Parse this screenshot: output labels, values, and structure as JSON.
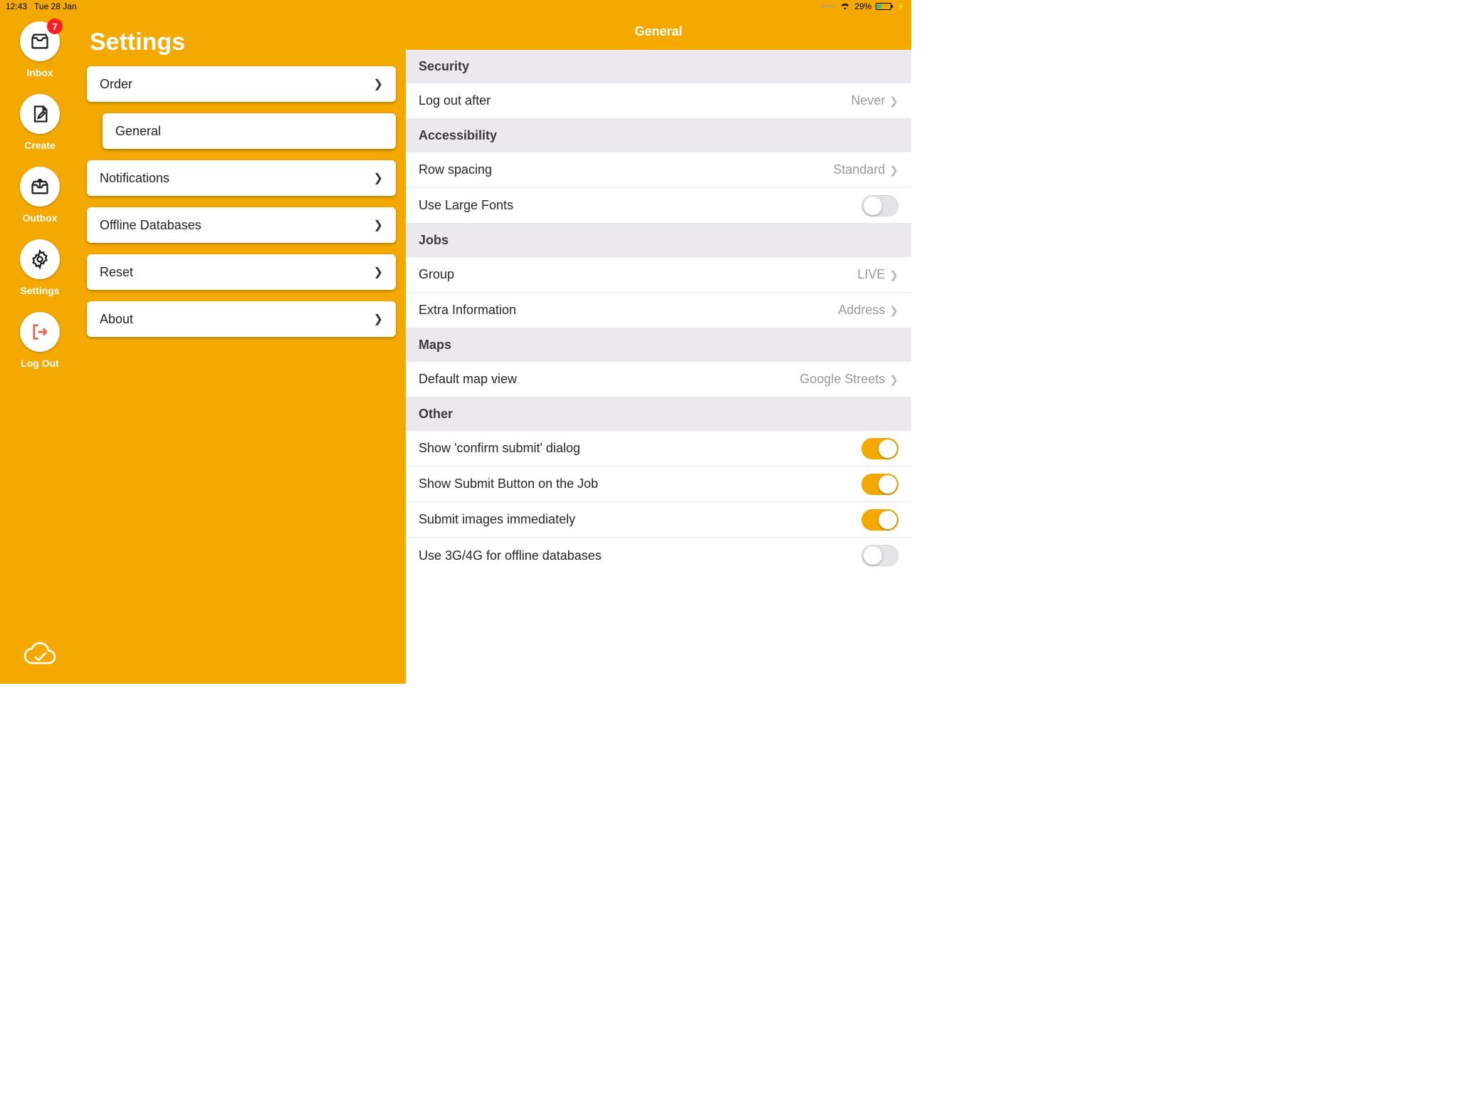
{
  "status": {
    "time": "12:43",
    "date": "Tue 28 Jan",
    "battery_pct": "29%"
  },
  "nav": {
    "items": [
      {
        "label": "Inbox",
        "badge": "7"
      },
      {
        "label": "Create"
      },
      {
        "label": "Outbox"
      },
      {
        "label": "Settings"
      },
      {
        "label": "Log Out"
      }
    ]
  },
  "settings": {
    "title": "Settings",
    "items": {
      "order": "Order",
      "general": "General",
      "notifications": "Notifications",
      "offline_db": "Offline Databases",
      "reset": "Reset",
      "about": "About"
    }
  },
  "detail": {
    "title": "General",
    "sections": {
      "security": {
        "header": "Security",
        "logout_label": "Log out after",
        "logout_value": "Never"
      },
      "accessibility": {
        "header": "Accessibility",
        "rowspacing_label": "Row spacing",
        "rowspacing_value": "Standard",
        "largefonts_label": "Use Large Fonts",
        "largefonts_on": false
      },
      "jobs": {
        "header": "Jobs",
        "group_label": "Group",
        "group_value": "LIVE",
        "extra_label": "Extra Information",
        "extra_value": "Address"
      },
      "maps": {
        "header": "Maps",
        "defaultmap_label": "Default map view",
        "defaultmap_value": "Google Streets"
      },
      "other": {
        "header": "Other",
        "confirm_label": "Show 'confirm submit' dialog",
        "confirm_on": true,
        "submitbtn_label": "Show Submit Button on the Job",
        "submitbtn_on": true,
        "submitimg_label": "Submit images immediately",
        "submitimg_on": true,
        "use3g_label": "Use 3G/4G for offline databases",
        "use3g_on": false
      }
    }
  }
}
